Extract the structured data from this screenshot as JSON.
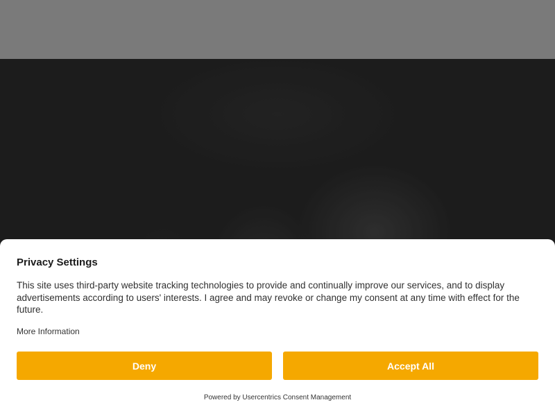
{
  "consent": {
    "title": "Privacy Settings",
    "body": "This site uses third-party website tracking technologies to provide and continually improve our services, and to display advertisements according to users' interests. I agree and may revoke or change my consent at any time with effect for the future.",
    "more_info_label": "More Information",
    "deny_label": "Deny",
    "accept_label": "Accept All",
    "powered_by": "Powered by Usercentrics Consent Management"
  },
  "colors": {
    "header_bg": "#7a7a7a",
    "button_bg": "#f5a800",
    "button_text": "#ffffff"
  }
}
